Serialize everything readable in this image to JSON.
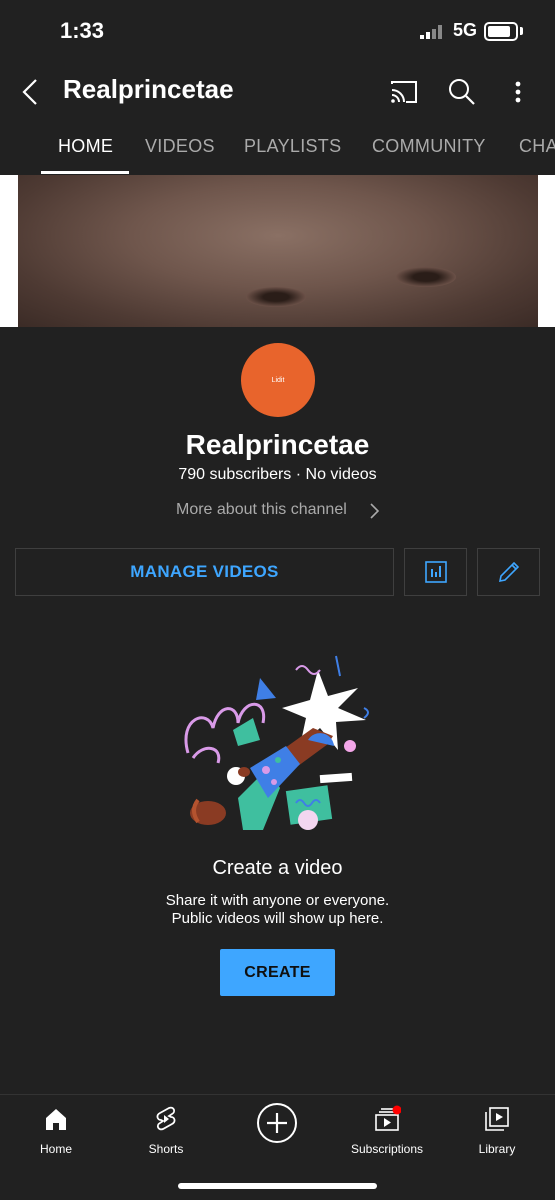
{
  "status_bar": {
    "time": "1:33",
    "network": "5G"
  },
  "app_bar": {
    "title": "Realprincetae"
  },
  "tabs": [
    {
      "label": "HOME",
      "active": true
    },
    {
      "label": "VIDEOS"
    },
    {
      "label": "PLAYLISTS"
    },
    {
      "label": "COMMUNITY"
    },
    {
      "label": "CHA"
    }
  ],
  "channel": {
    "avatar_text": "Lidit",
    "name": "Realprincetae",
    "stats": "790 subscribers · No videos",
    "more_about": "More about this channel"
  },
  "actions": {
    "manage_videos": "MANAGE VIDEOS"
  },
  "empty_state": {
    "title": "Create a video",
    "line1": "Share it with anyone or everyone.",
    "line2": "Public videos will show up here.",
    "button": "CREATE"
  },
  "bottom_nav": [
    {
      "label": "Home",
      "icon": "home-icon"
    },
    {
      "label": "Shorts",
      "icon": "shorts-icon"
    },
    {
      "label": "",
      "icon": "create-plus-icon"
    },
    {
      "label": "Subscriptions",
      "icon": "subscriptions-icon",
      "badge": true
    },
    {
      "label": "Library",
      "icon": "library-icon"
    }
  ],
  "colors": {
    "background": "#212121",
    "accent": "#3ea6ff",
    "avatar": "#e8642c",
    "badge": "#ff0000"
  }
}
